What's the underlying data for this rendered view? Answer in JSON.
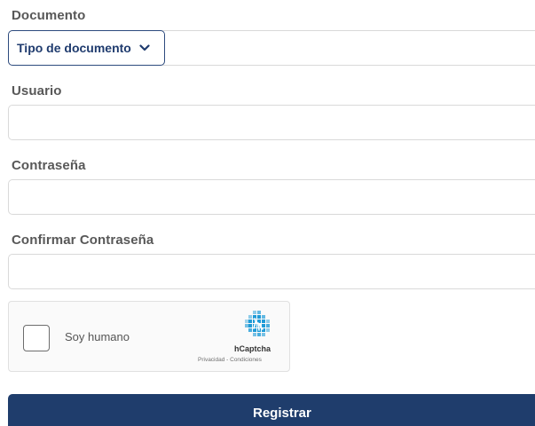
{
  "form": {
    "document_label": "Documento",
    "document_type": {
      "selected": "Tipo de documento",
      "icon": "chevron-down-icon"
    },
    "document_number_value": "",
    "username_label": "Usuario",
    "username_value": "",
    "password_label": "Contraseña",
    "password_value": "",
    "confirm_password_label": "Confirmar Contraseña",
    "confirm_password_value": ""
  },
  "captcha": {
    "checkbox_label": "Soy humano",
    "brand": "hCaptcha",
    "links": "Privacidad - Condiciones",
    "icon": "hcaptcha-logo-icon"
  },
  "submit": {
    "label": "Registrar"
  },
  "colors": {
    "primary": "#1f3d6c",
    "label_text": "#585858",
    "field_border": "#d9d9d9",
    "captcha_logo": "#1f9bd7"
  }
}
